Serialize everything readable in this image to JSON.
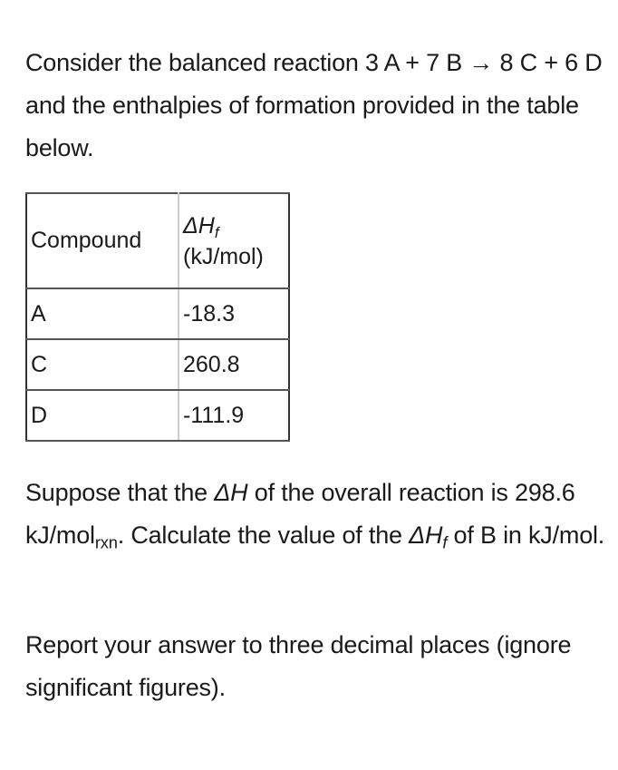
{
  "intro": {
    "text": "Consider the balanced reaction 3 A + 7 B → 8 C + 6 D and the enthalpies of formation provided in the table below.",
    "reaction": {
      "reactants": [
        {
          "coef": 3,
          "species": "A"
        },
        {
          "coef": 7,
          "species": "B"
        }
      ],
      "products": [
        {
          "coef": 8,
          "species": "C"
        },
        {
          "coef": 6,
          "species": "D"
        }
      ]
    }
  },
  "table": {
    "headers": {
      "compound": "Compound",
      "enthalpy_symbol": "ΔH",
      "enthalpy_subscript": "f",
      "enthalpy_unit": "(kJ/mol)"
    },
    "rows": [
      {
        "compound": "A",
        "value": "-18.3"
      },
      {
        "compound": "C",
        "value": "260.8"
      },
      {
        "compound": "D",
        "value": "-111.9"
      }
    ]
  },
  "question": {
    "part1": "Suppose that the ",
    "delta_h": "ΔH",
    "part2": " of the overall reaction is 298.6 kJ/mol",
    "rxn_sub": "rxn",
    "part3": ". Calculate the value of the ",
    "delta_hf": "ΔH",
    "hf_sub": "f",
    "part4": " of B in kJ/mol."
  },
  "instruction": {
    "text": "Report your answer to three decimal places (ignore significant figures)."
  }
}
